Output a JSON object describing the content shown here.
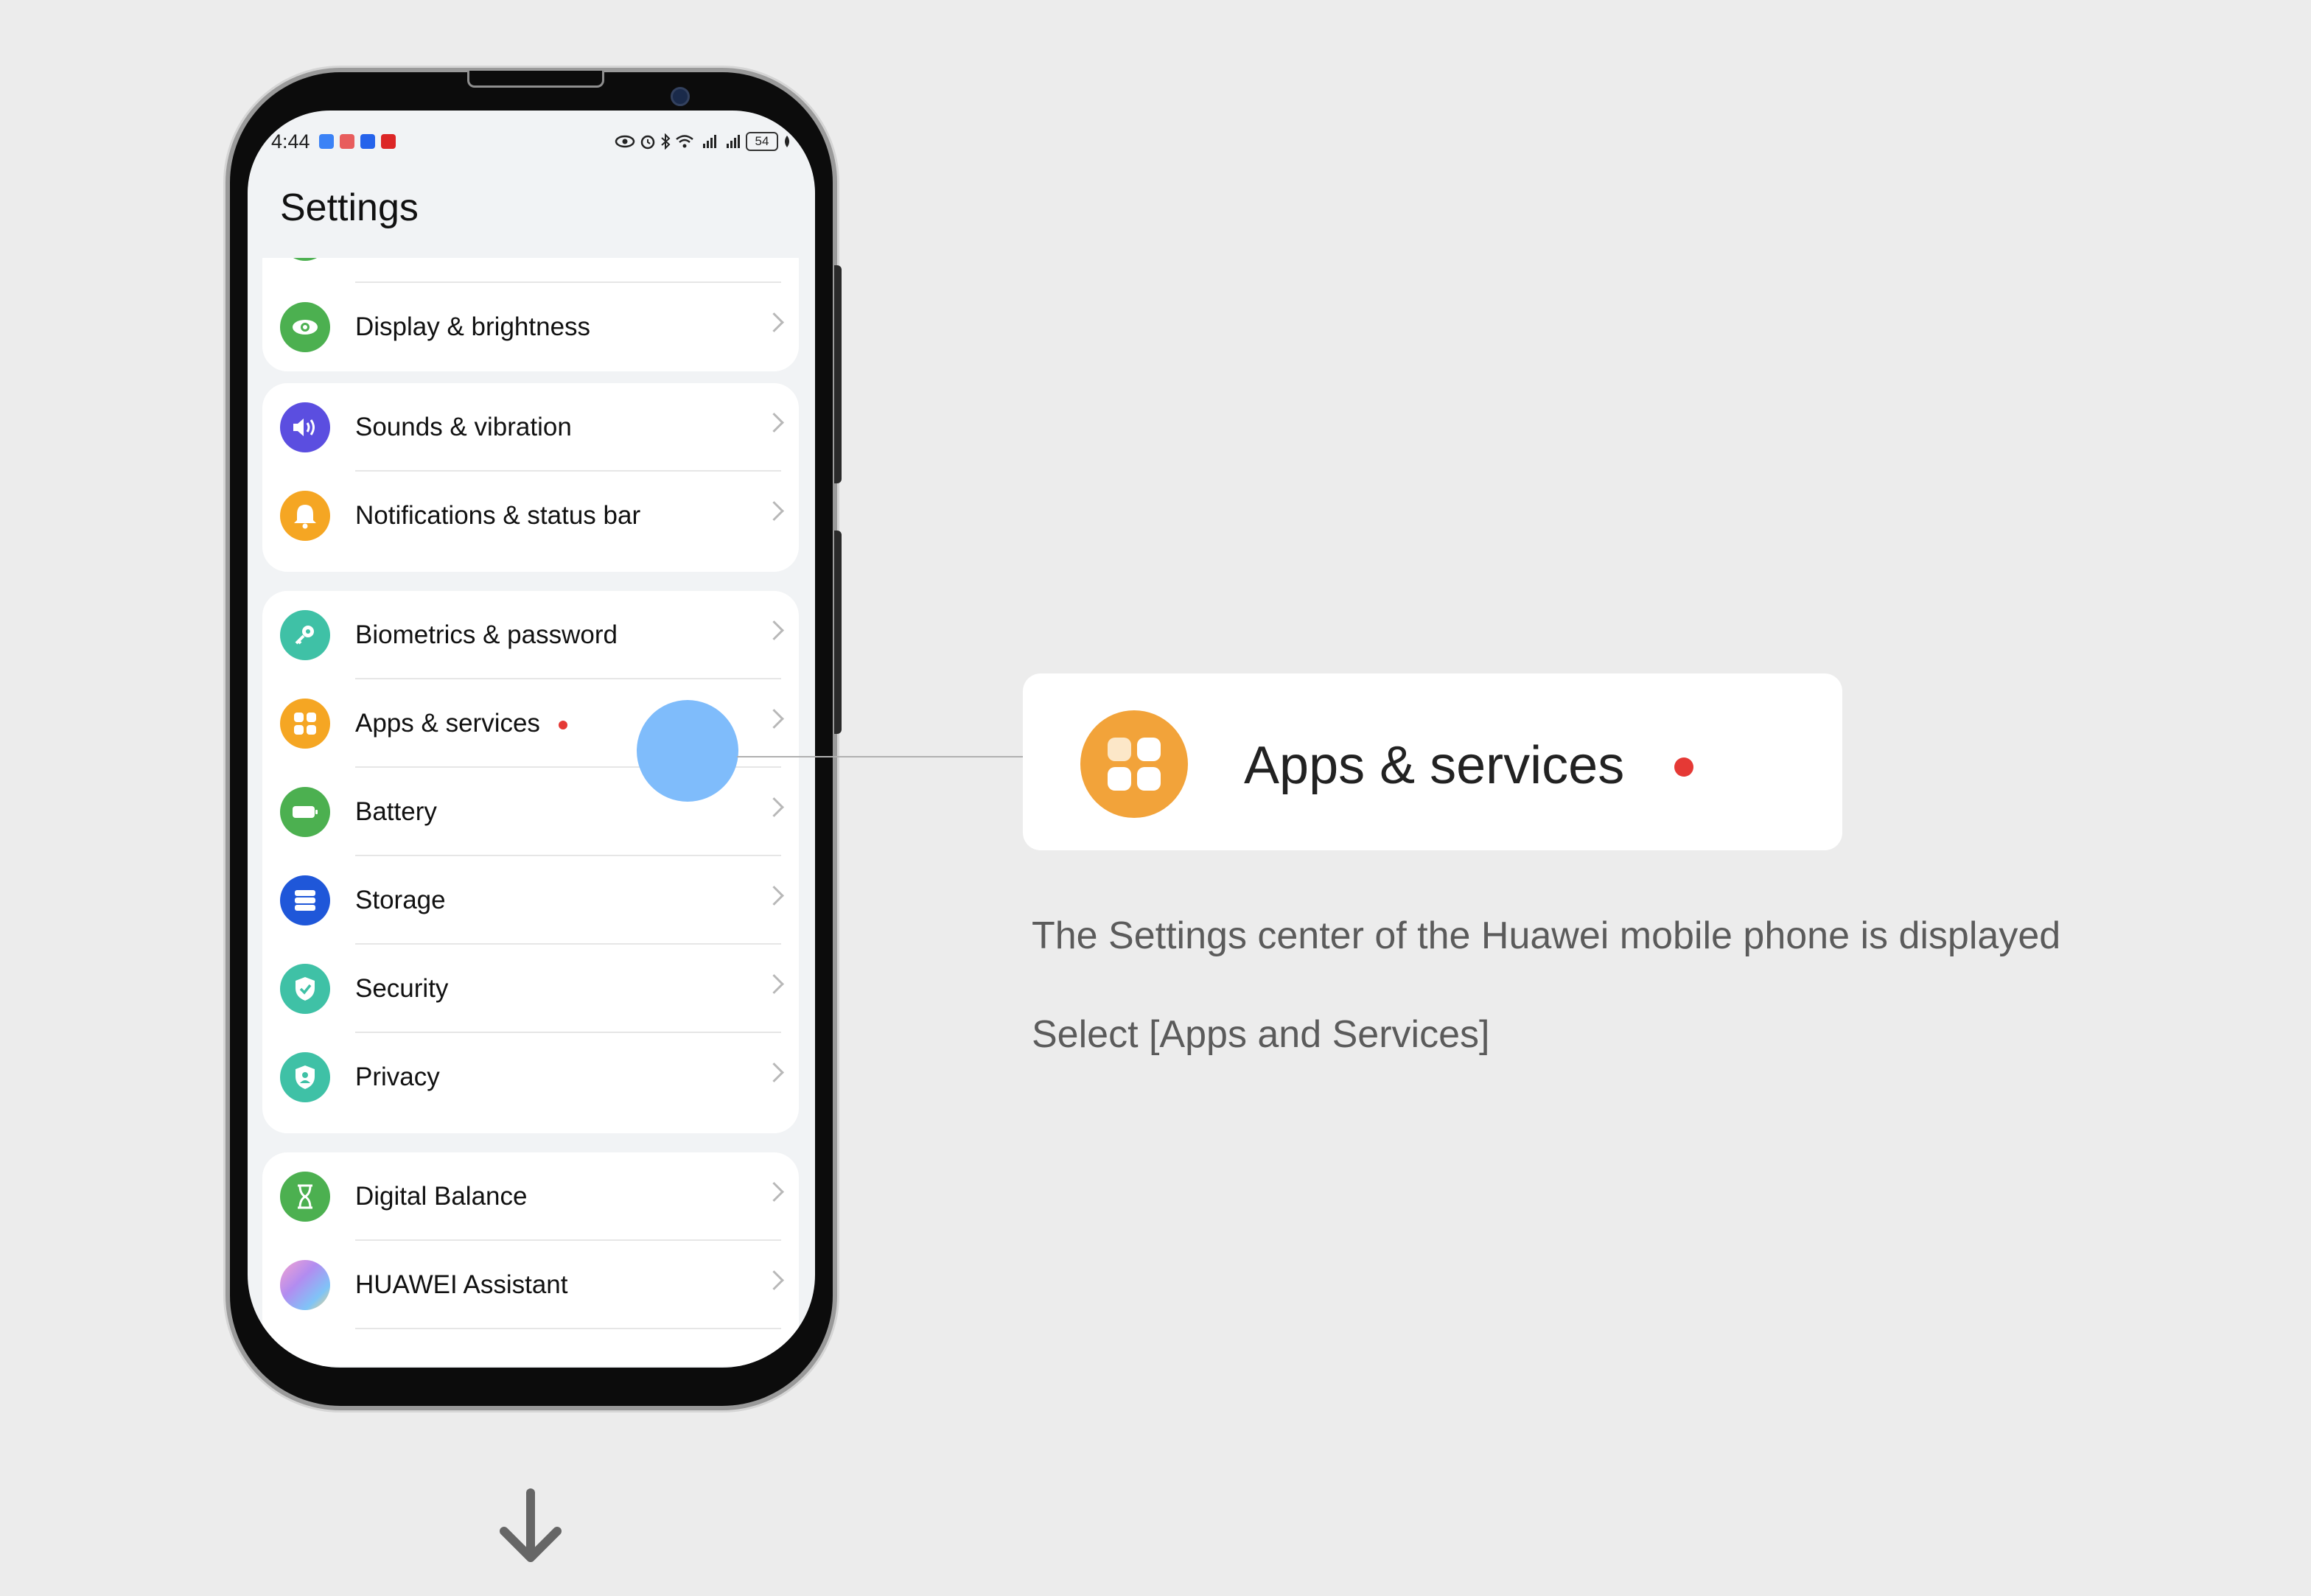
{
  "status_bar": {
    "time": "4:44",
    "battery_level": "54",
    "icons": [
      "eye-icon",
      "alarm-icon",
      "bluetooth-icon",
      "wifi-icon",
      "signal-icon",
      "signal-icon",
      "battery-icon",
      "leaf-icon"
    ]
  },
  "settings": {
    "title": "Settings",
    "groups": [
      {
        "items": [
          {
            "label": "Display & brightness",
            "icon": "eye-icon",
            "color": "#4cb050"
          }
        ]
      },
      {
        "items": [
          {
            "label": "Sounds & vibration",
            "icon": "speaker-icon",
            "color": "#5b4ee0"
          },
          {
            "label": "Notifications & status bar",
            "icon": "bell-icon",
            "color": "#f5a623"
          }
        ]
      },
      {
        "items": [
          {
            "label": "Biometrics & password",
            "icon": "key-icon",
            "color": "#3fc1a6"
          },
          {
            "label": "Apps & services",
            "icon": "apps-icon",
            "color": "#f5a623"
          },
          {
            "label": "Battery",
            "icon": "battery-icon",
            "color": "#4cb050"
          },
          {
            "label": "Storage",
            "icon": "storage-icon",
            "color": "#1f57d9"
          },
          {
            "label": "Security",
            "icon": "shield-check-icon",
            "color": "#3fc1a6"
          },
          {
            "label": "Privacy",
            "icon": "privacy-icon",
            "color": "#3fc1a6"
          }
        ]
      },
      {
        "items": [
          {
            "label": "Digital Balance",
            "icon": "hourglass-icon",
            "color": "#4cb050"
          },
          {
            "label": "HUAWEI Assistant",
            "icon": "assistant-icon",
            "color": "#c38ee8"
          }
        ]
      }
    ]
  },
  "callout": {
    "label": "Apps & services",
    "icon": "apps-icon",
    "accent": "#f2a33a",
    "dot_color": "#e53935"
  },
  "instructions": {
    "line1": "The Settings center of the Huawei mobile phone is displayed",
    "line2": "Select [Apps and Services]"
  },
  "colors": {
    "background": "#ececec",
    "touch_indicator": "#7fbcfb"
  }
}
